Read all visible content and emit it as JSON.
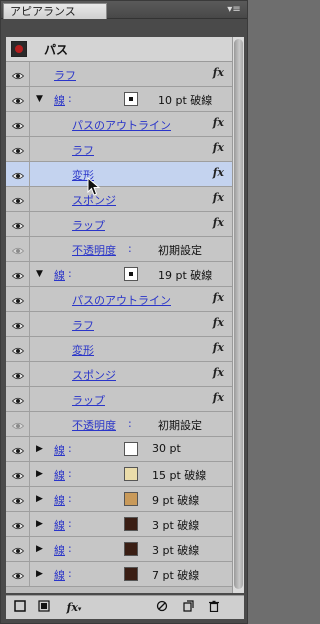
{
  "panel": {
    "tab_title": "アピアランス",
    "menu_icon": "panel-menu-icon"
  },
  "header": {
    "title": "パス"
  },
  "rows": [
    {
      "label": "ラフ",
      "fx": "fx"
    },
    {
      "label": "線",
      "colon": ":",
      "value": "10 pt 破線",
      "swatch": "#ffffff"
    },
    {
      "label": "パスのアウトライン",
      "fx": "fx"
    },
    {
      "label": "ラフ",
      "fx": "fx"
    },
    {
      "label": "変形",
      "fx": "fx"
    },
    {
      "label": "スポンジ",
      "fx": "fx"
    },
    {
      "label": "ラップ",
      "fx": "fx"
    },
    {
      "label": "不透明度",
      "colon": ":",
      "value": "初期設定"
    },
    {
      "label": "線",
      "colon": ":",
      "value": "19 pt 破線",
      "swatch": "#ffffff"
    },
    {
      "label": "パスのアウトライン",
      "fx": "fx"
    },
    {
      "label": "ラフ",
      "fx": "fx"
    },
    {
      "label": "変形",
      "fx": "fx"
    },
    {
      "label": "スポンジ",
      "fx": "fx"
    },
    {
      "label": "ラップ",
      "fx": "fx"
    },
    {
      "label": "不透明度",
      "colon": ":",
      "value": "初期設定"
    },
    {
      "label": "線",
      "colon": ":",
      "value": "30 pt",
      "swatch": "#ffffff"
    },
    {
      "label": "線",
      "colon": ":",
      "value": "15 pt 破線",
      "swatch": "#eadcaa"
    },
    {
      "label": "線",
      "colon": ":",
      "value": "9 pt 破線",
      "swatch": "#c99a5a"
    },
    {
      "label": "線",
      "colon": ":",
      "value": "3 pt 破線",
      "swatch": "#3a1e14"
    },
    {
      "label": "線",
      "colon": ":",
      "value": "3 pt 破線",
      "swatch": "#3a1e14"
    },
    {
      "label": "線",
      "colon": ":",
      "value": "7 pt 破線",
      "swatch": "#3a1e14"
    }
  ],
  "bottom": {
    "fx_label": "fx"
  }
}
